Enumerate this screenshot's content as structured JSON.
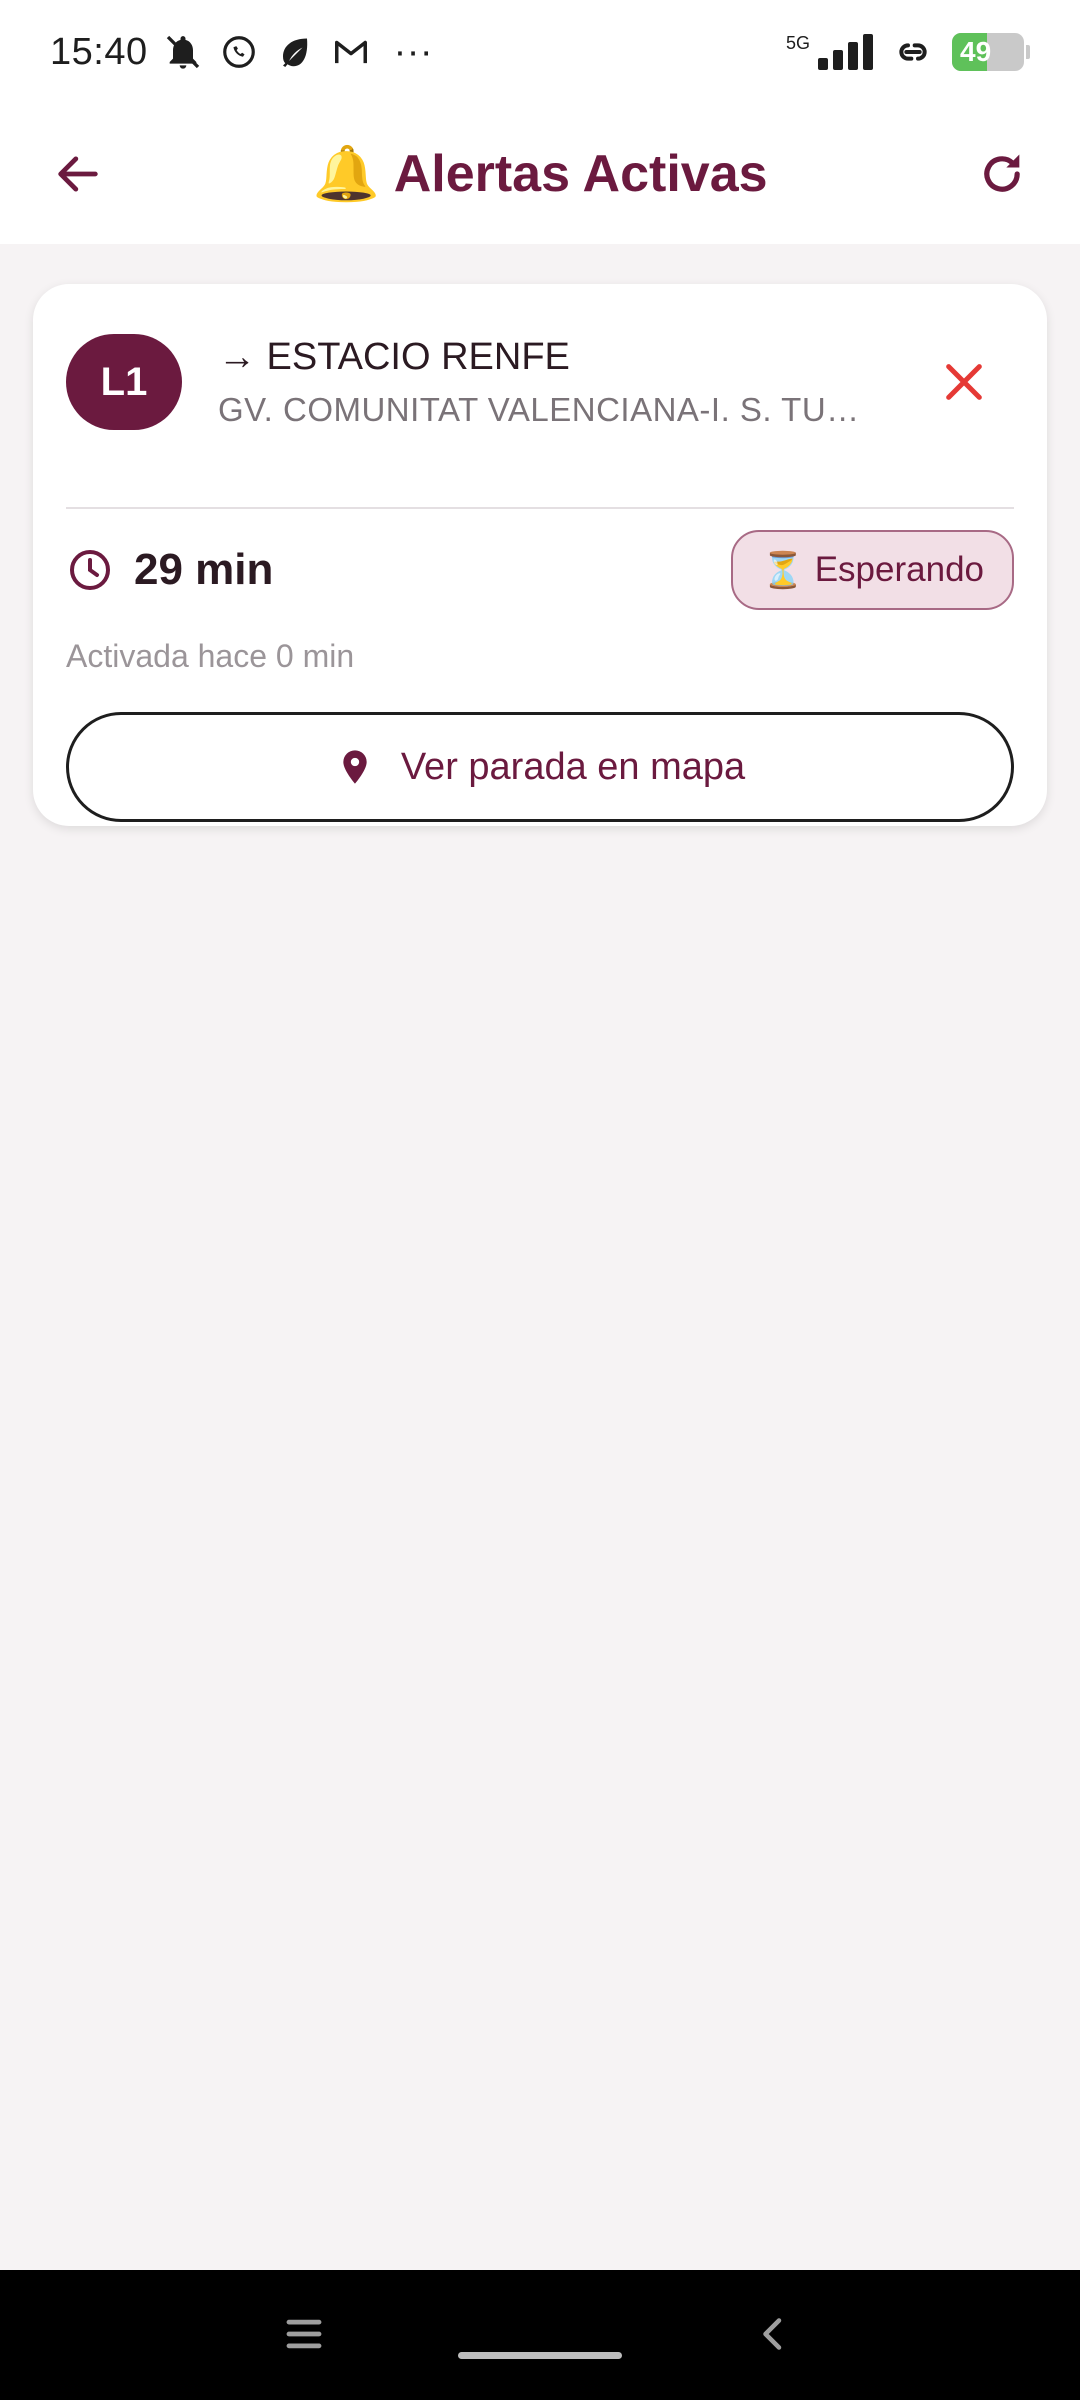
{
  "status_bar": {
    "time": "15:40",
    "more": "···",
    "network": "5G",
    "battery_level": "49",
    "battery_fraction": 0.49,
    "icons": [
      "bell-off-icon",
      "whatsapp-icon",
      "leaf-icon",
      "gmail-icon",
      "signal-icon",
      "link-icon",
      "battery-icon"
    ]
  },
  "app_bar": {
    "title": "Alertas Activas",
    "title_emoji": "🔔",
    "back_icon": "arrow-left-icon",
    "refresh_icon": "refresh-icon"
  },
  "alert_card": {
    "line": "L1",
    "destination": "→ ESTACIO RENFE",
    "stop": "GV. COMUNITAT VALENCIANA-I. S. TU…",
    "time_value": "29 min",
    "status_emoji": "⏳",
    "status": "Esperando",
    "activated": "Activada hace 0 min",
    "map_button_label": "Ver parada en mapa"
  },
  "colors": {
    "primary": "#6b1a3f",
    "close": "#e53935",
    "chip_bg": "#f2dfe6",
    "background": "#f6f3f4"
  }
}
